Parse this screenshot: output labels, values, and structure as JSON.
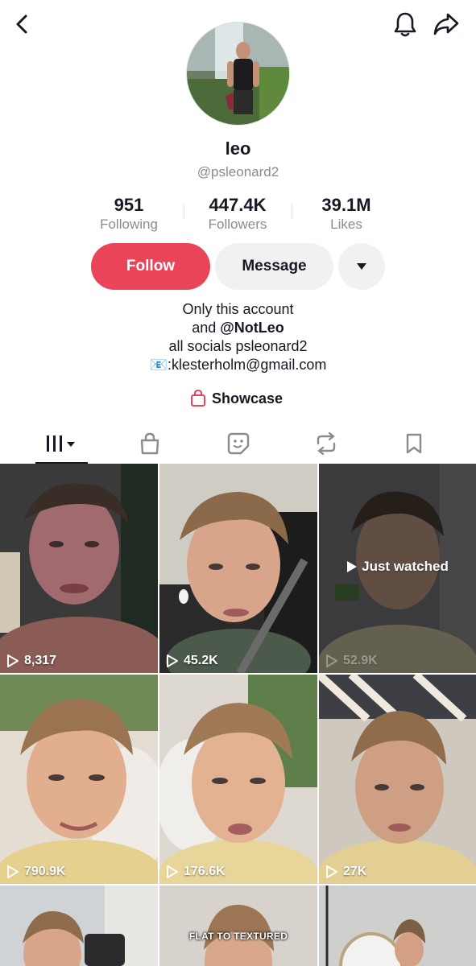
{
  "profile": {
    "display_name": "leo",
    "handle": "@psleonard2"
  },
  "stats": [
    {
      "value": "951",
      "label": "Following"
    },
    {
      "value": "447.4K",
      "label": "Followers"
    },
    {
      "value": "39.1M",
      "label": "Likes"
    }
  ],
  "actions": {
    "follow_label": "Follow",
    "message_label": "Message"
  },
  "bio": {
    "line1": "Only this account",
    "line2_prefix": "and ",
    "line2_mention": "@NotLeo",
    "line3": "all socials psleonard2",
    "line4_email_icon": "📧",
    "line4_text": ":klesterholm@gmail.com"
  },
  "showcase_label": "Showcase",
  "tabs": [
    {
      "icon": "videos-grid-icon",
      "active": true
    },
    {
      "icon": "shop-bag-icon",
      "active": false
    },
    {
      "icon": "sticker-icon",
      "active": false
    },
    {
      "icon": "repost-icon",
      "active": false
    },
    {
      "icon": "bookmark-icon",
      "active": false
    }
  ],
  "videos": [
    {
      "views": "8,317"
    },
    {
      "views": "45.2K"
    },
    {
      "views": "52.9K",
      "status": "Just watched"
    },
    {
      "views": "790.9K"
    },
    {
      "views": "176.6K"
    },
    {
      "views": "27K"
    },
    {
      "views": ""
    },
    {
      "views": "",
      "caption": "FLAT TO TEXTURED"
    },
    {
      "views": ""
    }
  ],
  "colors": {
    "follow": "#ea4459",
    "text": "#161823",
    "muted": "#8a8b91",
    "button_gray": "#f1f1f2"
  }
}
